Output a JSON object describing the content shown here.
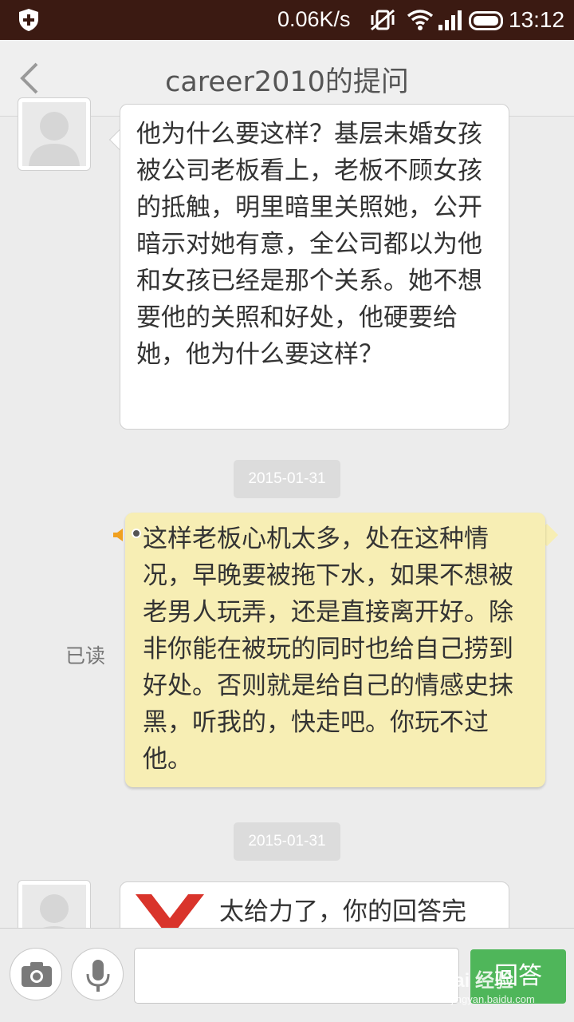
{
  "status_bar": {
    "speed": "0.06K/s",
    "time": "13:12"
  },
  "header": {
    "title": "career2010的提问",
    "back_icon": "chevron-left-icon"
  },
  "messages": [
    {
      "side": "left",
      "text": "他为什么要这样？基层未婚女孩被公司老板看上，老板不顾女孩的抵触，明里暗里关照她，公开暗示对她有意，全公司都以为他和女孩已经是那个关系。她不想要他的关照和好处，他硬要给她，他为什么要这样？"
    },
    {
      "side": "right",
      "date": "2015-01-31",
      "read_status": "已读",
      "text": "这样老板心机太多，处在这种情况，早晚要被拖下水，如果不想被老男人玩弄，还是直接离开好。除非你能在被玩的同时也给自己捞到好处。否则就是给自己的情感史抹黑，听我的，快走吧。你玩不过他。"
    },
    {
      "side": "left",
      "date": "2015-01-31",
      "text": "太给力了，你的回答完"
    }
  ],
  "input_bar": {
    "placeholder": "",
    "send_label": "回答",
    "camera_icon": "camera-icon",
    "mic_icon": "microphone-icon"
  },
  "watermark": {
    "brand": "Bai 经验",
    "url": "jingyan.baidu.com"
  },
  "colors": {
    "status_bar": "#3b1a12",
    "answer_bubble": "#f7eeb4",
    "send_button": "#4fb65a"
  }
}
